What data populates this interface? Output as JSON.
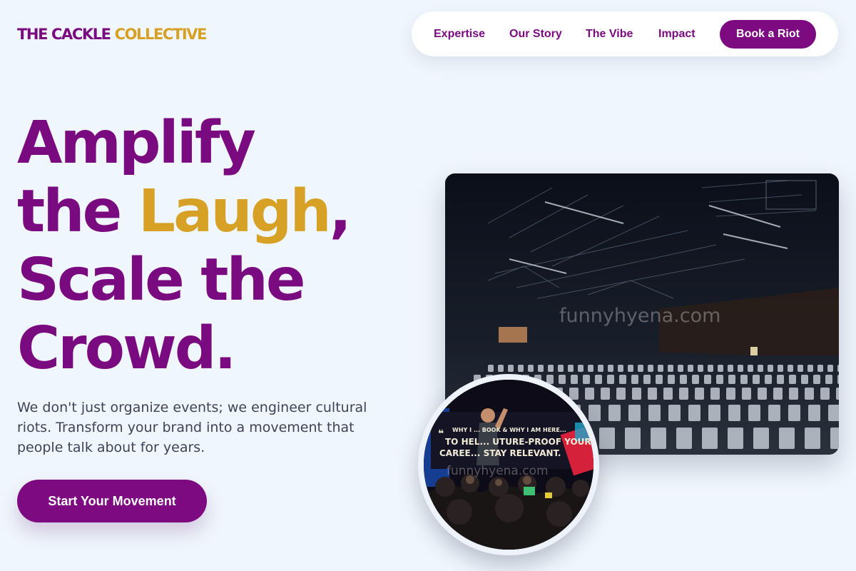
{
  "brand": {
    "part1": "THE CACKLE",
    "part2": "COLLECTIVE"
  },
  "nav": {
    "links": [
      "Expertise",
      "Our Story",
      "The Vibe",
      "Impact"
    ],
    "cta": "Book a Riot"
  },
  "hero": {
    "line1": "Amplify",
    "line2_start": "the ",
    "line2_accent": "Laugh",
    "line2_end": ",",
    "line3": "Scale the",
    "line4": "Crowd.",
    "subtext": "We don't just organize events; we engineer cultural riots. Transform your brand into a movement that people talk about for years.",
    "cta": "Start Your Movement"
  },
  "images": {
    "venue_watermark": "funnyhyena.com",
    "speaker_watermark": "funnyhyena.com",
    "screen_line1": "WHY I ... BOOK & WHY I AM HERE...",
    "screen_line2": "TO HEL... UTURE-PROOF YOUR",
    "screen_line3": "CAREE... STAY RELEVANT."
  },
  "colors": {
    "primary": "#7a0a7f",
    "accent": "#d7a125",
    "background": "#f0f6fd",
    "body_text": "#3c4456"
  }
}
